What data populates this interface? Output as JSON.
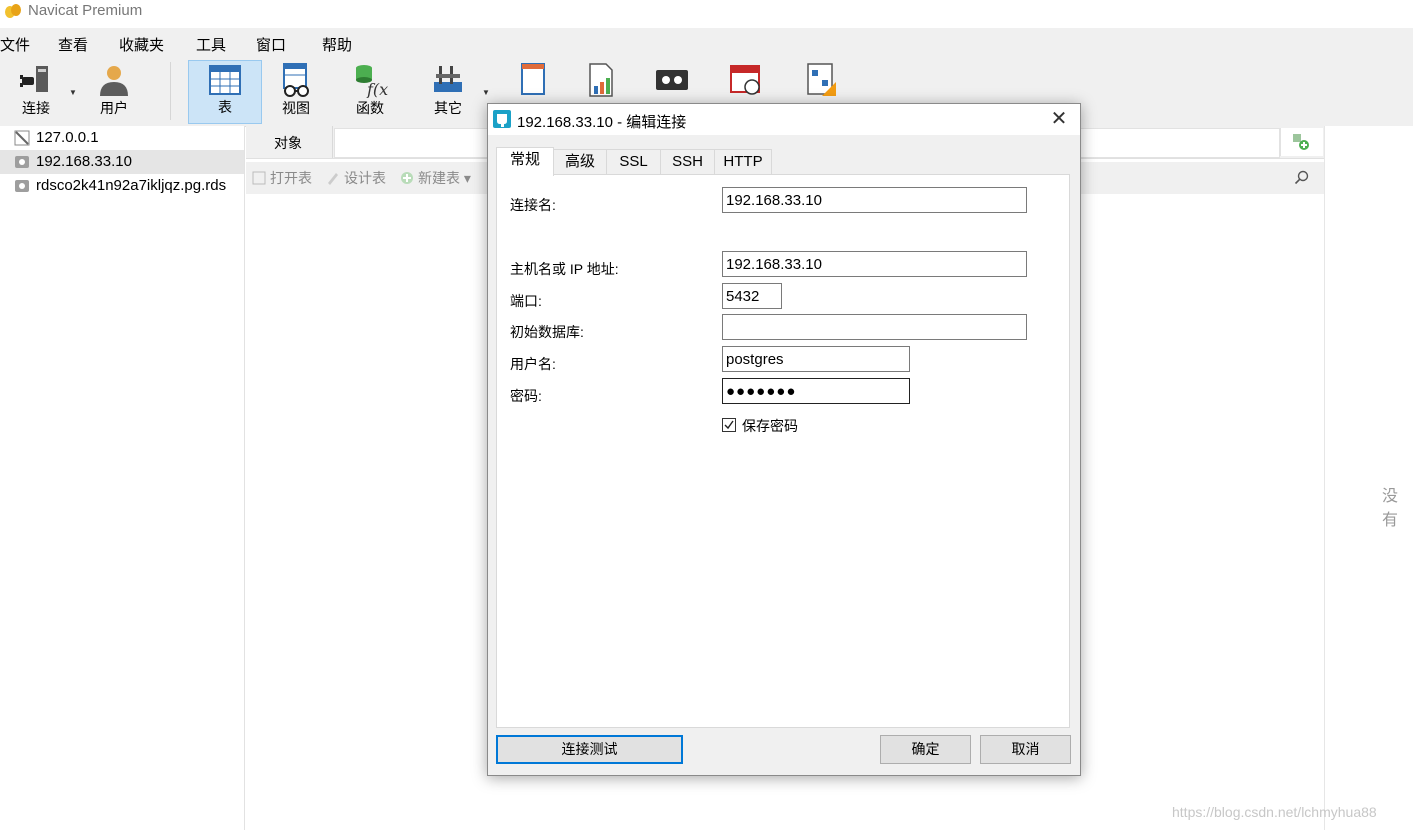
{
  "app": {
    "title": "Navicat Premium"
  },
  "menu": [
    "文件",
    "查看",
    "收藏夹",
    "工具",
    "窗口",
    "帮助"
  ],
  "toolbar": {
    "connect": "连接",
    "user": "用户",
    "table": "表",
    "view": "视图",
    "function": "函数",
    "other": "其它"
  },
  "sidebar": {
    "items": [
      {
        "label": "127.0.0.1",
        "icon": "mysql-connection-icon"
      },
      {
        "label": "192.168.33.10",
        "icon": "postgresql-connection-icon"
      },
      {
        "label": "rdsco2k41n92a7ikljqz.pg.rds",
        "icon": "postgresql-connection-icon"
      }
    ],
    "selected": "192.168.33.10"
  },
  "main": {
    "tab_objects": "对象",
    "obj_toolbar": {
      "open_table": "打开表",
      "design_table": "设计表",
      "new_table": "新建表"
    },
    "right_empty": "没有"
  },
  "dialog": {
    "title": "192.168.33.10 - 编辑连接",
    "tabs": [
      "常规",
      "高级",
      "SSL",
      "SSH",
      "HTTP"
    ],
    "active_tab": "常规",
    "fields": {
      "conn_name_label": "连接名:",
      "conn_name_value": "192.168.33.10",
      "host_label": "主机名或 IP 地址:",
      "host_value": "192.168.33.10",
      "port_label": "端口:",
      "port_value": "5432",
      "db_label": "初始数据库:",
      "db_value": "",
      "user_label": "用户名:",
      "user_value": "postgres",
      "pwd_label": "密码:",
      "pwd_value": "●●●●●●●",
      "save_pwd_label": "保存密码",
      "save_pwd_checked": true
    },
    "buttons": {
      "test": "连接测试",
      "ok": "确定",
      "cancel": "取消"
    }
  },
  "watermark": "https://blog.csdn.net/lchmyhua88"
}
